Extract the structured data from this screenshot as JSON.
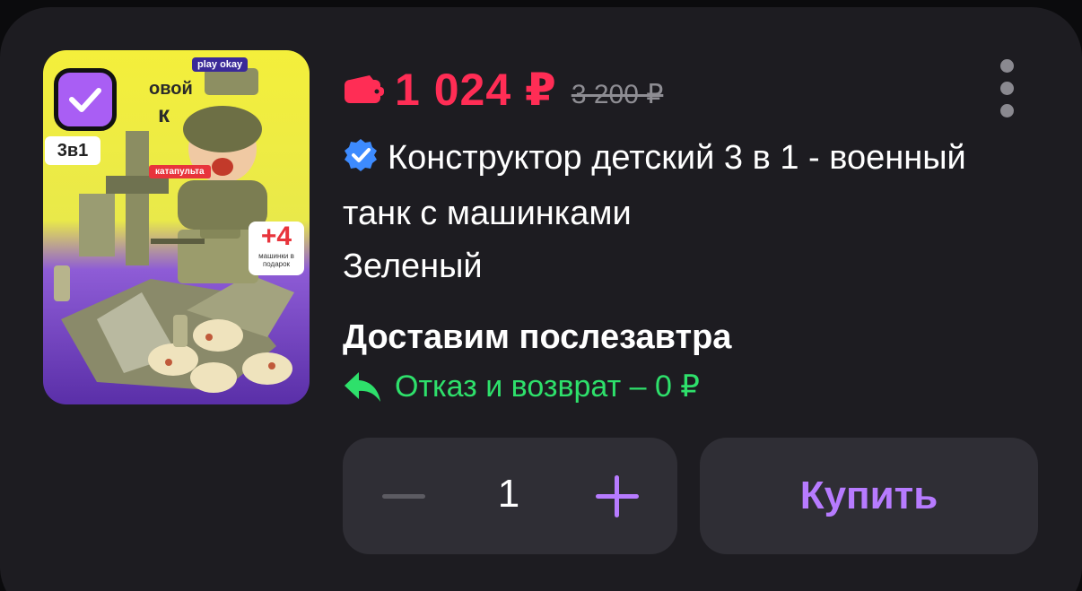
{
  "product": {
    "image": {
      "alt": "Конструктор детский 3 в 1",
      "brand_badge": "play okay",
      "corner_text_a": "овой",
      "corner_text_b": "к",
      "three_in_one": "3в1",
      "catapult_tag": "катапульта",
      "plus_count": "+4",
      "plus_caption": "машинки в подарок"
    },
    "selected": true,
    "price": "1 024 ₽",
    "old_price": "3 200 ₽",
    "title": "Конструктор детский 3 в 1 - военный танк с машинками",
    "variant": "Зеленый",
    "delivery": "Доставим послезавтра",
    "return_policy": "Отказ и возврат – 0 ₽",
    "quantity": "1",
    "buy_label": "Купить"
  },
  "colors": {
    "price": "#ff2d55",
    "accent": "#b77bff",
    "return_green": "#2ee06b",
    "card_bg": "#1d1c21",
    "control_bg": "#2f2e35"
  },
  "icons": [
    "checkbox-check-icon",
    "wallet-icon",
    "verified-badge-icon",
    "more-vertical-icon",
    "return-arrow-icon",
    "minus-icon",
    "plus-icon"
  ]
}
